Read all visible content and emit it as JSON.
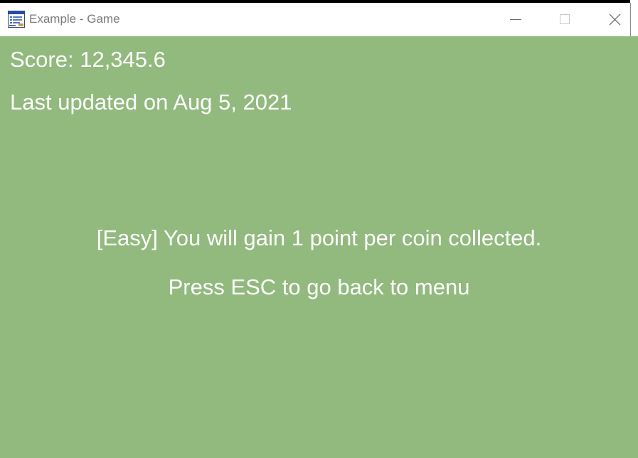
{
  "window": {
    "title": "Example - Game",
    "app_icon": "window-app-icon",
    "controls": {
      "minimize_icon": "minimize-icon",
      "maximize_icon": "maximize-icon",
      "close_icon": "close-icon"
    }
  },
  "game": {
    "background_color": "#92b97e",
    "text_color": "#ffffff",
    "score_text": "Score: 12,345.6",
    "updated_text": "Last updated on Aug 5, 2021",
    "difficulty_message": "[Easy] You will gain 1 point per coin collected.",
    "esc_message": "Press ESC to go back to menu"
  }
}
